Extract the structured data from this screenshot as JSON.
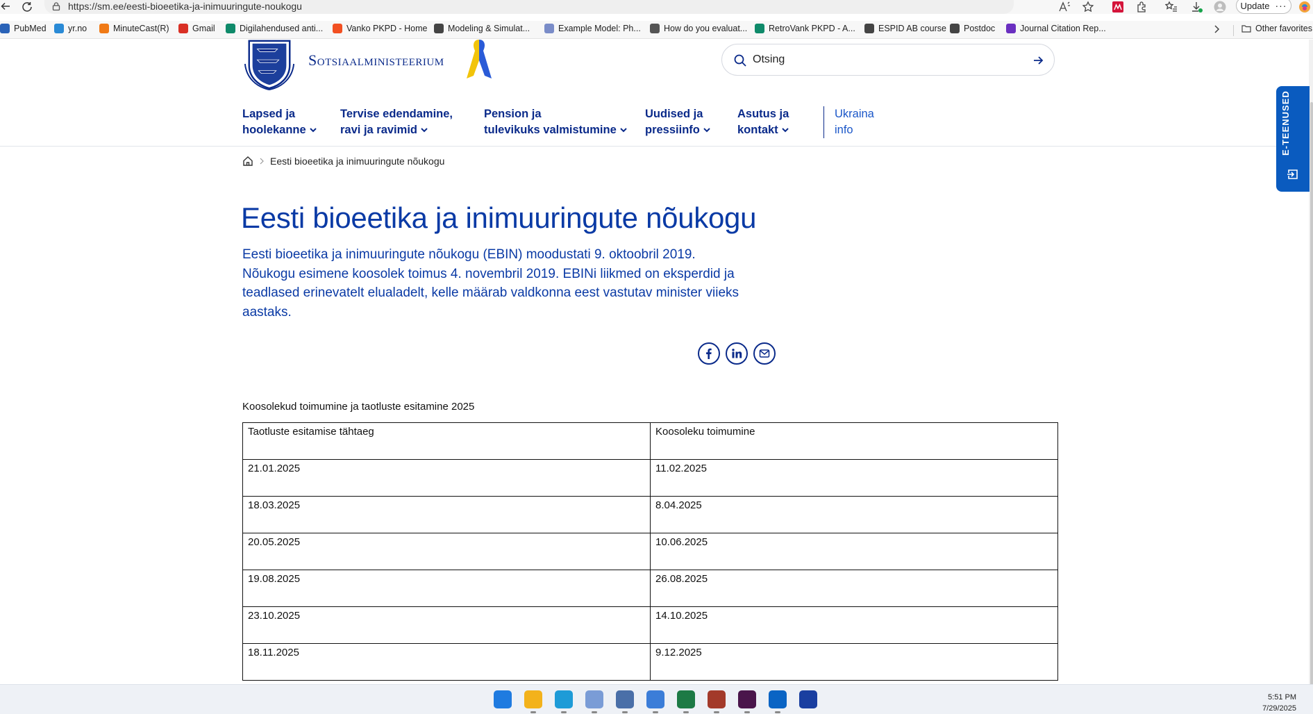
{
  "browser": {
    "url": "https://sm.ee/eesti-bioeetika-ja-inimuuringute-noukogu",
    "update_label": "Update",
    "update_more": "···",
    "bookmarks": [
      {
        "label": "PubMed",
        "color": "#2a63b8"
      },
      {
        "label": "yr.no",
        "color": "#2a8ad6"
      },
      {
        "label": "MinuteCast(R)",
        "color": "#f07a16"
      },
      {
        "label": "Gmail",
        "color": "#d93025"
      },
      {
        "label": "Digilahendused anti...",
        "color": "#0f8a6a"
      },
      {
        "label": "Vanko PKPD - Home",
        "color": "#f25022"
      },
      {
        "label": "Modeling & Simulat...",
        "color": "#444444"
      },
      {
        "label": "Example Model: Ph...",
        "color": "#7a8cc8"
      },
      {
        "label": "How do you evaluat...",
        "color": "#555555"
      },
      {
        "label": "RetroVank PKPD - A...",
        "color": "#0f8a6a"
      },
      {
        "label": "ESPID AB course",
        "color": "#444444"
      },
      {
        "label": "Postdoc",
        "color": "#444444"
      },
      {
        "label": "Journal Citation Rep...",
        "color": "#6a2fc0"
      }
    ],
    "other_favorites": "Other favorites"
  },
  "site": {
    "org_name": "Sotsiaalministeerium",
    "search_placeholder": "Otsing",
    "nav": [
      {
        "line1": "Lapsed ja",
        "line2": "hoolekanne"
      },
      {
        "line1": "Tervise edendamine,",
        "line2": "ravi ja ravimid"
      },
      {
        "line1": "Pension ja",
        "line2": "tulevikuks valmistumine"
      },
      {
        "line1": "Uudised ja",
        "line2": "pressiinfo"
      },
      {
        "line1": "Asutus ja",
        "line2": "kontakt"
      }
    ],
    "nav_extra": {
      "line1": "Ukraina",
      "line2": "info"
    },
    "e_services_label": "E-TEENUSED",
    "accent_color": "#0a2a8a"
  },
  "breadcrumb": {
    "current": "Eesti bioeetika ja inimuuringute nõukogu"
  },
  "main": {
    "title": "Eesti bioeetika ja inimuuringute nõukogu",
    "lead": "Eesti bioeetika ja inimuuringute nõukogu (EBIN) moodustati 9. oktoobril 2019. Nõukogu esimene koosolek toimus 4. novembril 2019. EBINi liikmed on eksperdid ja teadlased erinevatelt elualadelt, kelle määrab valdkonna eest vastutav minister viieks aastaks.",
    "share": [
      "facebook-icon",
      "linkedin-icon",
      "mail-icon"
    ],
    "table_caption": "Koosolekud toimumine ja taotluste esitamine 2025",
    "table": {
      "headers": [
        "Taotluste esitamise tähtaeg",
        "Koosoleku toimumine"
      ],
      "rows": [
        [
          "21.01.2025",
          "11.02.2025"
        ],
        [
          "18.03.2025",
          "8.04.2025"
        ],
        [
          "20.05.2025",
          "10.06.2025"
        ],
        [
          "19.08.2025",
          "26.08.2025"
        ],
        [
          "23.10.2025",
          "14.10.2025"
        ],
        [
          "18.11.2025",
          "9.12.2025"
        ]
      ]
    }
  },
  "taskbar": {
    "apps": [
      {
        "name": "windows-start-icon",
        "color": "#1f7be0"
      },
      {
        "name": "file-explorer-icon",
        "color": "#f3b21b"
      },
      {
        "name": "edge-browser-icon",
        "color": "#1e9bd7"
      },
      {
        "name": "r-app-icon",
        "color": "#7a9cd6"
      },
      {
        "name": "remote-desktop-icon",
        "color": "#4a6fa8"
      },
      {
        "name": "notepad-icon",
        "color": "#3b7dd8"
      },
      {
        "name": "excel-icon",
        "color": "#1d7a45"
      },
      {
        "name": "firewall-app-icon",
        "color": "#a33a2a"
      },
      {
        "name": "slack-icon",
        "color": "#4a154b"
      },
      {
        "name": "outlook-icon",
        "color": "#0a64c4"
      },
      {
        "name": "id-card-icon",
        "color": "#1a3fa0"
      }
    ],
    "time": "5:51 PM",
    "date": "7/29/2025"
  }
}
